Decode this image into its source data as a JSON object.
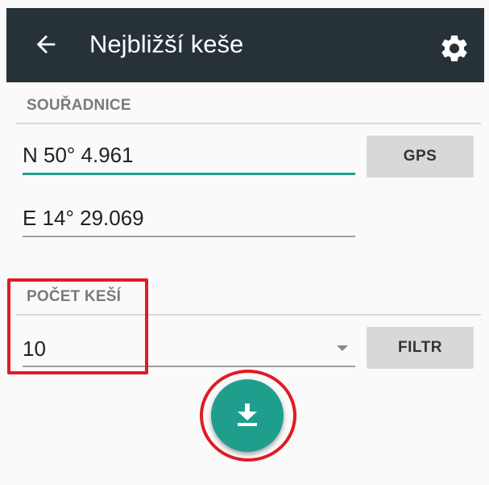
{
  "appbar": {
    "title": "Nejbližší keše",
    "back_icon": "arrow-left-icon",
    "settings_icon": "gear-icon"
  },
  "coordinates": {
    "section_label": "SOUŘADNICE",
    "latitude": "N 50° 4.961",
    "longitude": "E 14° 29.069",
    "gps_button": "GPS"
  },
  "cache_count": {
    "section_label": "POČET KEŠÍ",
    "value": "10",
    "dropdown_icon": "triangle-down-icon",
    "filter_button": "FILTR"
  },
  "fab": {
    "icon": "download-icon"
  },
  "colors": {
    "appbar": "#263238",
    "accent": "#1f9e8e",
    "highlight": "#e21b23",
    "button": "#d8d8d8"
  }
}
